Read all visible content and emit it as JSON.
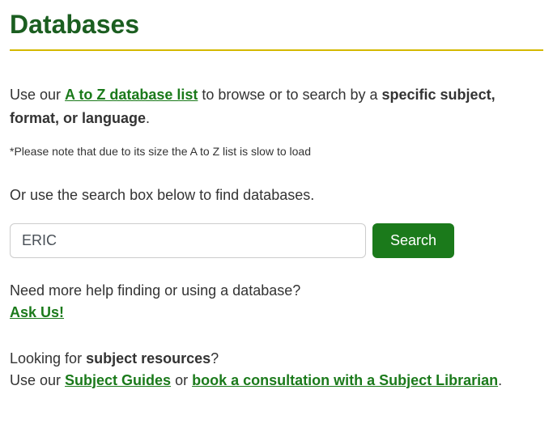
{
  "title": "Databases",
  "intro": {
    "prefix": "Use our ",
    "link": "A to Z database list",
    "middle": " to browse or to search by a ",
    "bold": "specific subject, format, or language",
    "suffix": "."
  },
  "note": "*Please note that due to its size the A to Z list is slow to load",
  "instruction": "Or use the search box below to find databases.",
  "search": {
    "value": "ERIC",
    "button": "Search"
  },
  "help": {
    "question": "Need more help finding or using a database?",
    "ask_link": "Ask Us!"
  },
  "subject": {
    "question_prefix": "Looking for ",
    "question_bold": "subject resources",
    "question_suffix": "?",
    "use_prefix": "Use our ",
    "guides_link": "Subject Guides",
    "or": " or ",
    "consult_link": "book a consultation with a Subject Librarian",
    "suffix": "."
  }
}
